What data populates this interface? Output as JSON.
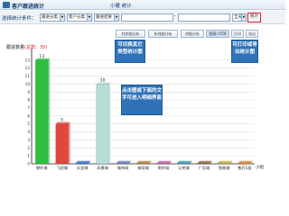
{
  "window": {
    "title": "客户跟进统计",
    "subtitle": "小暖 统计",
    "range_label": "本月"
  },
  "filter": {
    "label": "选择统计条件：",
    "select1": "跟进分类",
    "select2": "客户分类",
    "select3": "跟进结果",
    "range_select": "全天",
    "stat_button": "统计"
  },
  "tabs": [
    {
      "label": "柱状图分析"
    },
    {
      "label": "折线图分析"
    },
    {
      "label": "饼图分析"
    },
    {
      "label": "图表<558"
    },
    {
      "label": "打印"
    },
    {
      "label": "导出"
    }
  ],
  "callouts": {
    "switch": "可切换其它类型统计图",
    "print": "可打印或导出统计图",
    "detail": "点击图或下面的文字可进入明细界面"
  },
  "chart_title": {
    "prefix": "跟进数量",
    "total": "(总数：35)"
  },
  "x_unit": "小组",
  "chart_data": {
    "type": "bar",
    "categories": [
      "野外城",
      "飞虎城",
      "天龙城",
      "风景城",
      "城市网",
      "接续城",
      "南外城",
      "公关城",
      "广告城",
      "智能城",
      "售后1组"
    ],
    "values": [
      13,
      5,
      0,
      10,
      0,
      0,
      0,
      0,
      0,
      0,
      0
    ],
    "data_labels": [
      "13",
      "5",
      "",
      "10",
      "",
      "",
      "",
      "",
      "",
      "",
      ""
    ],
    "y_ticks": [
      "13",
      "12",
      "11",
      "10",
      "9",
      "8",
      "7",
      "6",
      "5",
      "4",
      "3",
      "2",
      "1",
      "0"
    ],
    "ylim": [
      0,
      14
    ],
    "colors": [
      "#2fbf3f",
      "#e0463c",
      "#3a6fd0",
      "#b6dcd8",
      "#6a7dc8",
      "#b9803a",
      "#c85fa8",
      "#3a9ab8",
      "#8a6a3a",
      "#c8b03a",
      "#e08a2f"
    ],
    "grid": true
  }
}
